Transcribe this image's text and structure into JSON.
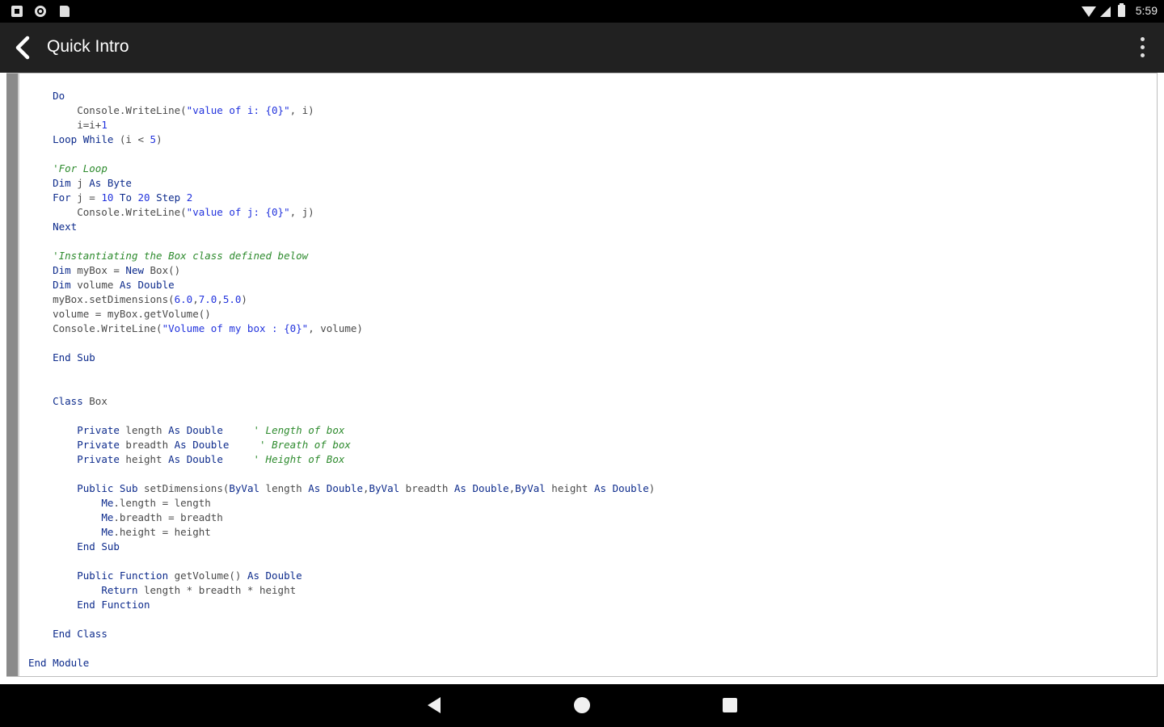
{
  "status_bar": {
    "time": "5:59",
    "icons": [
      "notification-icon",
      "sync-icon",
      "sd-card-icon",
      "wifi-icon",
      "signal-icon",
      "battery-icon"
    ]
  },
  "app_bar": {
    "title": "Quick Intro",
    "back_icon": "arrow-back-icon",
    "menu_icon": "more-vert-icon"
  },
  "code": {
    "language": "VB.NET",
    "lines": [
      [
        {
          "t": "    "
        },
        {
          "t": "Do",
          "c": "kw"
        }
      ],
      [
        {
          "t": "        Console.WriteLine("
        },
        {
          "t": "\"value of i: {0}\"",
          "c": "str"
        },
        {
          "t": ", i)"
        }
      ],
      [
        {
          "t": "        i=i+"
        },
        {
          "t": "1",
          "c": "num"
        }
      ],
      [
        {
          "t": "    "
        },
        {
          "t": "Loop While",
          "c": "kw"
        },
        {
          "t": " (i < "
        },
        {
          "t": "5",
          "c": "num"
        },
        {
          "t": ")"
        }
      ],
      [
        {
          "t": ""
        }
      ],
      [
        {
          "t": "    "
        },
        {
          "t": "'For Loop",
          "c": "cmt"
        }
      ],
      [
        {
          "t": "    "
        },
        {
          "t": "Dim",
          "c": "kw"
        },
        {
          "t": " j "
        },
        {
          "t": "As Byte",
          "c": "kw"
        }
      ],
      [
        {
          "t": "    "
        },
        {
          "t": "For",
          "c": "kw"
        },
        {
          "t": " j = "
        },
        {
          "t": "10",
          "c": "num"
        },
        {
          "t": " "
        },
        {
          "t": "To",
          "c": "kw"
        },
        {
          "t": " "
        },
        {
          "t": "20",
          "c": "num"
        },
        {
          "t": " "
        },
        {
          "t": "Step",
          "c": "kw"
        },
        {
          "t": " "
        },
        {
          "t": "2",
          "c": "num"
        }
      ],
      [
        {
          "t": "        Console.WriteLine("
        },
        {
          "t": "\"value of j: {0}\"",
          "c": "str"
        },
        {
          "t": ", j)"
        }
      ],
      [
        {
          "t": "    "
        },
        {
          "t": "Next",
          "c": "kw"
        }
      ],
      [
        {
          "t": ""
        }
      ],
      [
        {
          "t": "    "
        },
        {
          "t": "'Instantiating the Box class defined below",
          "c": "cmt"
        }
      ],
      [
        {
          "t": "    "
        },
        {
          "t": "Dim",
          "c": "kw"
        },
        {
          "t": " myBox = "
        },
        {
          "t": "New",
          "c": "kw"
        },
        {
          "t": " Box()"
        }
      ],
      [
        {
          "t": "    "
        },
        {
          "t": "Dim",
          "c": "kw"
        },
        {
          "t": " volume "
        },
        {
          "t": "As Double",
          "c": "kw"
        }
      ],
      [
        {
          "t": "    myBox.setDimensions("
        },
        {
          "t": "6.0",
          "c": "num"
        },
        {
          "t": ","
        },
        {
          "t": "7.0",
          "c": "num"
        },
        {
          "t": ","
        },
        {
          "t": "5.0",
          "c": "num"
        },
        {
          "t": ")"
        }
      ],
      [
        {
          "t": "    volume = myBox.getVolume()"
        }
      ],
      [
        {
          "t": "    Console.WriteLine("
        },
        {
          "t": "\"Volume of my box : {0}\"",
          "c": "str"
        },
        {
          "t": ", volume)"
        }
      ],
      [
        {
          "t": ""
        }
      ],
      [
        {
          "t": "    "
        },
        {
          "t": "End Sub",
          "c": "kw"
        }
      ],
      [
        {
          "t": ""
        }
      ],
      [
        {
          "t": ""
        }
      ],
      [
        {
          "t": "    "
        },
        {
          "t": "Class",
          "c": "kw"
        },
        {
          "t": " Box"
        }
      ],
      [
        {
          "t": ""
        }
      ],
      [
        {
          "t": "        "
        },
        {
          "t": "Private",
          "c": "kw"
        },
        {
          "t": " length "
        },
        {
          "t": "As Double",
          "c": "kw"
        },
        {
          "t": "     "
        },
        {
          "t": "' Length of box",
          "c": "cmt"
        }
      ],
      [
        {
          "t": "        "
        },
        {
          "t": "Private",
          "c": "kw"
        },
        {
          "t": " breadth "
        },
        {
          "t": "As Double",
          "c": "kw"
        },
        {
          "t": "     "
        },
        {
          "t": "' Breath of box",
          "c": "cmt"
        }
      ],
      [
        {
          "t": "        "
        },
        {
          "t": "Private",
          "c": "kw"
        },
        {
          "t": " height "
        },
        {
          "t": "As Double",
          "c": "kw"
        },
        {
          "t": "     "
        },
        {
          "t": "' Height of Box",
          "c": "cmt"
        }
      ],
      [
        {
          "t": ""
        }
      ],
      [
        {
          "t": "        "
        },
        {
          "t": "Public Sub",
          "c": "kw"
        },
        {
          "t": " setDimensions("
        },
        {
          "t": "ByVal",
          "c": "kw"
        },
        {
          "t": " length "
        },
        {
          "t": "As Double",
          "c": "kw"
        },
        {
          "t": ","
        },
        {
          "t": "ByVal",
          "c": "kw"
        },
        {
          "t": " breadth "
        },
        {
          "t": "As Double",
          "c": "kw"
        },
        {
          "t": ","
        },
        {
          "t": "ByVal",
          "c": "kw"
        },
        {
          "t": " height "
        },
        {
          "t": "As Double",
          "c": "kw"
        },
        {
          "t": ")"
        }
      ],
      [
        {
          "t": "            "
        },
        {
          "t": "Me",
          "c": "kw"
        },
        {
          "t": ".length = length"
        }
      ],
      [
        {
          "t": "            "
        },
        {
          "t": "Me",
          "c": "kw"
        },
        {
          "t": ".breadth = breadth"
        }
      ],
      [
        {
          "t": "            "
        },
        {
          "t": "Me",
          "c": "kw"
        },
        {
          "t": ".height = height"
        }
      ],
      [
        {
          "t": "        "
        },
        {
          "t": "End Sub",
          "c": "kw"
        }
      ],
      [
        {
          "t": ""
        }
      ],
      [
        {
          "t": "        "
        },
        {
          "t": "Public Function",
          "c": "kw"
        },
        {
          "t": " getVolume() "
        },
        {
          "t": "As Double",
          "c": "kw"
        }
      ],
      [
        {
          "t": "            "
        },
        {
          "t": "Return",
          "c": "kw"
        },
        {
          "t": " length * breadth * height"
        }
      ],
      [
        {
          "t": "        "
        },
        {
          "t": "End Function",
          "c": "kw"
        }
      ],
      [
        {
          "t": ""
        }
      ],
      [
        {
          "t": "    "
        },
        {
          "t": "End Class",
          "c": "kw"
        }
      ],
      [
        {
          "t": ""
        }
      ],
      [
        {
          "t": "End Module",
          "c": "kw"
        }
      ]
    ]
  },
  "nav_bar": {
    "buttons": [
      "back-triangle-icon",
      "home-circle-icon",
      "recents-square-icon"
    ]
  }
}
